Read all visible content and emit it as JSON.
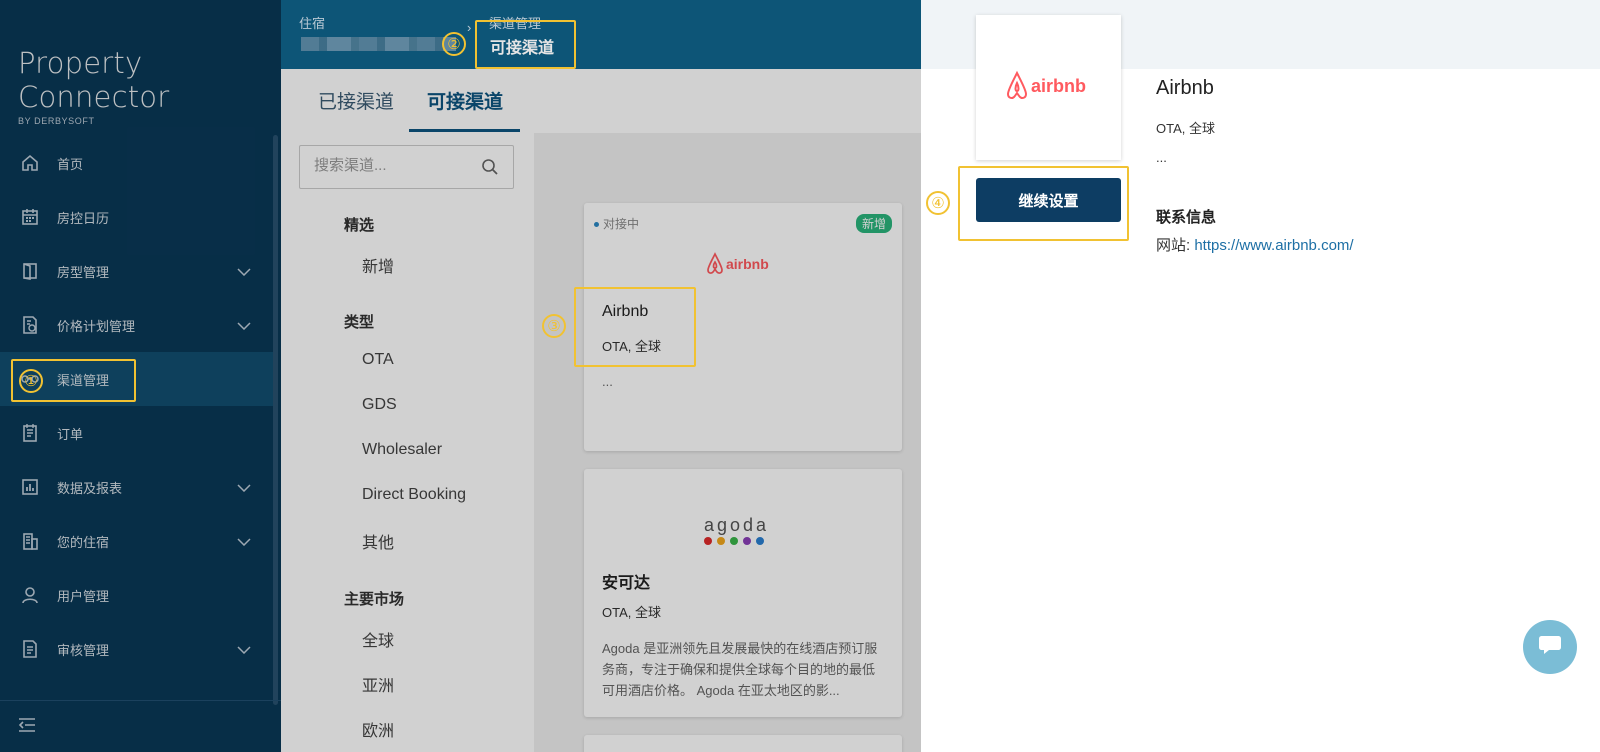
{
  "brand": {
    "name": "Property Connector",
    "by": "BY DERBYSOFT"
  },
  "sidebar": {
    "items": [
      {
        "label": "首页",
        "icon": "home-icon",
        "has_sub": false
      },
      {
        "label": "房控日历",
        "icon": "calendar-icon",
        "has_sub": false
      },
      {
        "label": "房型管理",
        "icon": "door-icon",
        "has_sub": true
      },
      {
        "label": "价格计划管理",
        "icon": "price-doc-icon",
        "has_sub": true
      },
      {
        "label": "渠道管理",
        "icon": "channel-icon",
        "has_sub": false,
        "active": true
      },
      {
        "label": "订单",
        "icon": "order-icon",
        "has_sub": false
      },
      {
        "label": "数据及报表",
        "icon": "chart-icon",
        "has_sub": true
      },
      {
        "label": "您的住宿",
        "icon": "building-icon",
        "has_sub": true
      },
      {
        "label": "用户管理",
        "icon": "user-icon",
        "has_sub": false
      },
      {
        "label": "审核管理",
        "icon": "audit-icon",
        "has_sub": true
      }
    ],
    "collapse_icon": "collapse-menu-icon"
  },
  "breadcrumb": {
    "parent": "住宿",
    "sep": "›",
    "middle": "渠道管理",
    "current": "可接渠道"
  },
  "tabs": {
    "connected": "已接渠道",
    "available": "可接渠道"
  },
  "search": {
    "placeholder": "搜索渠道..."
  },
  "filters": {
    "featured": {
      "title": "精选",
      "options": [
        "新增"
      ]
    },
    "type": {
      "title": "类型",
      "options": [
        "OTA",
        "GDS",
        "Wholesaler",
        "Direct Booking",
        "其他"
      ]
    },
    "market": {
      "title": "主要市场",
      "options": [
        "全球",
        "亚洲",
        "欧洲"
      ]
    }
  },
  "cards": [
    {
      "status": "对接中",
      "badge": "新增",
      "logo": "airbnb",
      "name": "Airbnb",
      "meta": "OTA, 全球",
      "desc": "..."
    },
    {
      "logo": "agoda",
      "name": "安可达",
      "meta": "OTA, 全球",
      "desc": "Agoda 是亚洲领先且发展最快的在线酒店预订服务商，专注于确保和提供全球每个目的地的最低可用酒店价格。 Agoda 在亚太地区的影..."
    }
  ],
  "detail": {
    "logo": "airbnb",
    "name": "Airbnb",
    "meta": "OTA, 全球",
    "desc": "...",
    "button": "继续设置",
    "contact_title": "联系信息",
    "site_label": "网站: ",
    "site_url": "https://www.airbnb.com/"
  },
  "annotations": [
    "①",
    "②",
    "③",
    "④"
  ],
  "colors": {
    "sidebar": "#0a3b5c",
    "topbar": "#0f5f85",
    "accent": "#0d3d63",
    "highlight": "#f1c232",
    "airbnb": "#ff5a5f",
    "new_badge": "#2ab57d"
  }
}
